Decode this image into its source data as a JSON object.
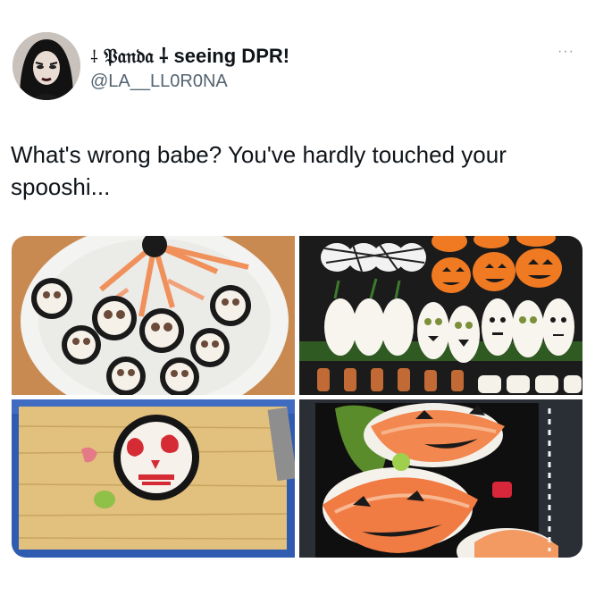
{
  "author": {
    "name_prefix_glyph": "⸸",
    "name_fraktur": "𝔓𝔞𝔫𝔡𝔞",
    "name_suffix": "⸸ seeing DPR!",
    "handle": "@LA__LL0R0NA"
  },
  "tweet": {
    "text": "What's wrong babe? You've hardly touched your spooshi...",
    "more_label": "···"
  },
  "media": {
    "images": [
      {
        "icon": "skull-sushi-plate-photo"
      },
      {
        "icon": "halloween-bento-photo"
      },
      {
        "icon": "skull-roll-board-photo"
      },
      {
        "icon": "pumpkin-nigiri-photo"
      }
    ]
  },
  "colors": {
    "text": "#0f1419",
    "secondary": "#536471",
    "salmon": "#f08a4b",
    "nori": "#1c1c1c"
  }
}
